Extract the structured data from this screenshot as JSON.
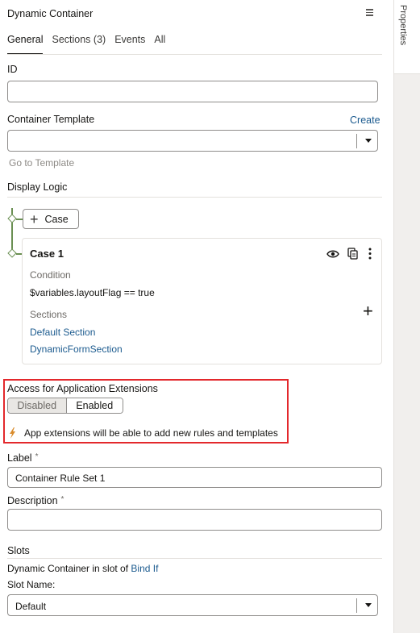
{
  "panel": {
    "title": "Dynamic Container",
    "tabs": [
      "General",
      "Sections (3)",
      "Events",
      "All"
    ]
  },
  "side_tab": {
    "label": "Properties"
  },
  "id_field": {
    "label": "ID",
    "value": ""
  },
  "container_template": {
    "label": "Container Template",
    "create_link": "Create",
    "value": "",
    "go_to_link": "Go to Template"
  },
  "display_logic": {
    "label": "Display Logic",
    "add_case_label": "Case",
    "case": {
      "title": "Case 1",
      "condition_label": "Condition",
      "condition_value": "$variables.layoutFlag == true",
      "sections_label": "Sections",
      "sections": [
        "Default Section",
        "DynamicFormSection"
      ]
    }
  },
  "access": {
    "label": "Access for Application Extensions",
    "options": [
      "Disabled",
      "Enabled"
    ],
    "selected": "Enabled",
    "hint": "App extensions will be able to add new rules and templates"
  },
  "label_field": {
    "label": "Label",
    "required": "*",
    "value": "Container Rule Set 1"
  },
  "description_field": {
    "label": "Description",
    "required": "*",
    "value": ""
  },
  "slots": {
    "label": "Slots",
    "in_slot_text": "Dynamic Container in slot of",
    "in_slot_link": "Bind If",
    "slot_name_label": "Slot Name:",
    "slot_name_value": "Default"
  },
  "colors": {
    "link": "#1c5b8f",
    "highlight": "#e3282c",
    "connector": "#6a8f52",
    "bolt": "#d98b2b"
  }
}
